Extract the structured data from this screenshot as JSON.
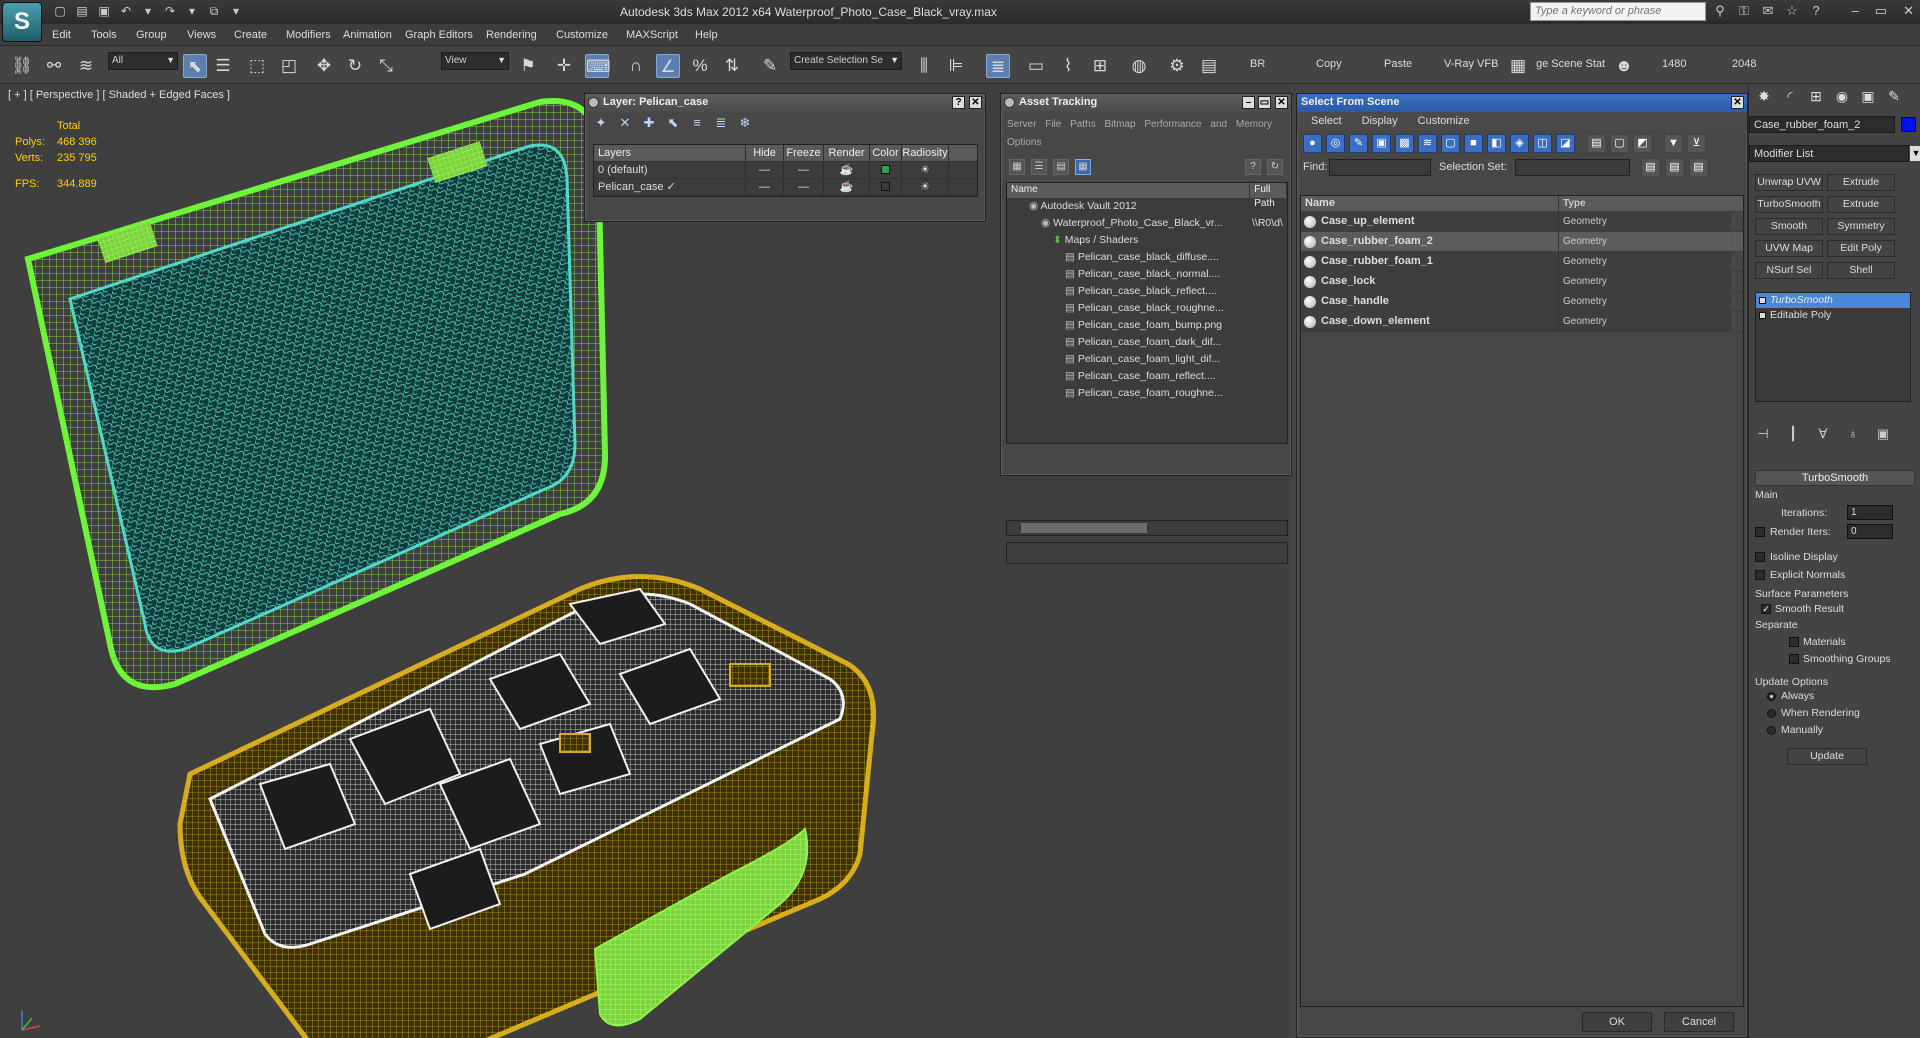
{
  "app": {
    "title": "Autodesk 3ds Max  2012 x64      Waterproof_Photo_Case_Black_vray.max",
    "logo_letter": "S"
  },
  "search": {
    "placeholder": "Type a keyword or phrase"
  },
  "menu": [
    "Edit",
    "Tools",
    "Group",
    "Views",
    "Create",
    "Modifiers",
    "Animation",
    "Graph Editors",
    "Rendering",
    "Customize",
    "MAXScript",
    "Help"
  ],
  "toolbar": {
    "selection_filter": "All",
    "ref_coord": "View",
    "named_selection": "Create Selection Se",
    "labels": {
      "br": "BR",
      "copy": "Copy",
      "paste": "Paste",
      "vray_vfb": "V-Ray VFB",
      "scene_stat": "ge Scene Stat",
      "res_1480": "1480",
      "res_2048": "2048"
    }
  },
  "viewport": {
    "label": "[ + ] [ Perspective ] [ Shaded + Edged Faces ]",
    "stats_header": "Total",
    "polys_label": "Polys:",
    "polys": "468 396",
    "verts_label": "Verts:",
    "verts": "235 795",
    "fps_label": "FPS:",
    "fps": "344.889"
  },
  "layer_window": {
    "title": "Layer: Pelican_case",
    "columns": [
      "Layers",
      "Hide",
      "Freeze",
      "Render",
      "Color",
      "Radiosity"
    ],
    "rows": [
      {
        "name": "0 (default)",
        "color": "#2fa14a",
        "hide": "—",
        "freeze": "—"
      },
      {
        "name": "Pelican_case",
        "color": "#3c3c3c",
        "hide": "—",
        "freeze": "—"
      }
    ]
  },
  "asset_window": {
    "title": "Asset Tracking",
    "menu1": "Server   File   Paths   Bitmap Performance and Memory",
    "menu2": "Options",
    "columns": [
      "Name",
      "Full Path"
    ],
    "tree": [
      {
        "label": "Autodesk Vault 2012",
        "indent": 1,
        "path": ""
      },
      {
        "label": "Waterproof_Photo_Case_Black_vr...",
        "indent": 2,
        "path": "\\\\R0\\d\\"
      },
      {
        "label": "Maps / Shaders",
        "indent": 3,
        "path": ""
      },
      {
        "label": "Pelican_case_black_diffuse....",
        "indent": 4,
        "path": ""
      },
      {
        "label": "Pelican_case_black_normal....",
        "indent": 4,
        "path": ""
      },
      {
        "label": "Pelican_case_black_reflect....",
        "indent": 4,
        "path": ""
      },
      {
        "label": "Pelican_case_black_roughne...",
        "indent": 4,
        "path": ""
      },
      {
        "label": "Pelican_case_foam_bump.png",
        "indent": 4,
        "path": ""
      },
      {
        "label": "Pelican_case_foam_dark_dif...",
        "indent": 4,
        "path": ""
      },
      {
        "label": "Pelican_case_foam_light_dif...",
        "indent": 4,
        "path": ""
      },
      {
        "label": "Pelican_case_foam_reflect....",
        "indent": 4,
        "path": ""
      },
      {
        "label": "Pelican_case_foam_roughne...",
        "indent": 4,
        "path": ""
      }
    ]
  },
  "sfs_window": {
    "title": "Select From Scene",
    "menu": [
      "Select",
      "Display",
      "Customize"
    ],
    "find_label": "Find:",
    "selset_label": "Selection Set:",
    "columns": [
      "Name",
      "Type"
    ],
    "rows": [
      {
        "name": "Case_up_element",
        "type": "Geometry",
        "selected": false
      },
      {
        "name": "Case_rubber_foam_2",
        "type": "Geometry",
        "selected": true
      },
      {
        "name": "Case_rubber_foam_1",
        "type": "Geometry",
        "selected": false
      },
      {
        "name": "Case_lock",
        "type": "Geometry",
        "selected": false
      },
      {
        "name": "Case_handle",
        "type": "Geometry",
        "selected": false
      },
      {
        "name": "Case_down_element",
        "type": "Geometry",
        "selected": false
      }
    ],
    "ok": "OK",
    "cancel": "Cancel"
  },
  "command_panel": {
    "object_name": "Case_rubber_foam_2",
    "object_color": "#0011ee",
    "modifier_list": "Modifier List",
    "buttons": [
      "Unwrap UVW",
      "Extrude",
      "TurboSmooth",
      "Extrude",
      "Smooth",
      "Symmetry",
      "UVW Map",
      "Edit Poly",
      "NSurf Sel",
      "Shell"
    ],
    "stack": [
      "TurboSmooth",
      "Editable Poly"
    ],
    "turbosmooth": {
      "title": "TurboSmooth",
      "main": "Main",
      "iterations_label": "Iterations:",
      "iterations": "1",
      "render_iters_label": "Render Iters:",
      "render_iters": "0",
      "isoline": "Isoline Display",
      "explicit": "Explicit Normals",
      "surface": "Surface Parameters",
      "smooth_result": "Smooth Result",
      "separate": "Separate",
      "materials": "Materials",
      "smoothing_groups": "Smoothing Groups",
      "update_options": "Update Options",
      "always": "Always",
      "when_rendering": "When Rendering",
      "manually": "Manually",
      "update": "Update"
    }
  }
}
